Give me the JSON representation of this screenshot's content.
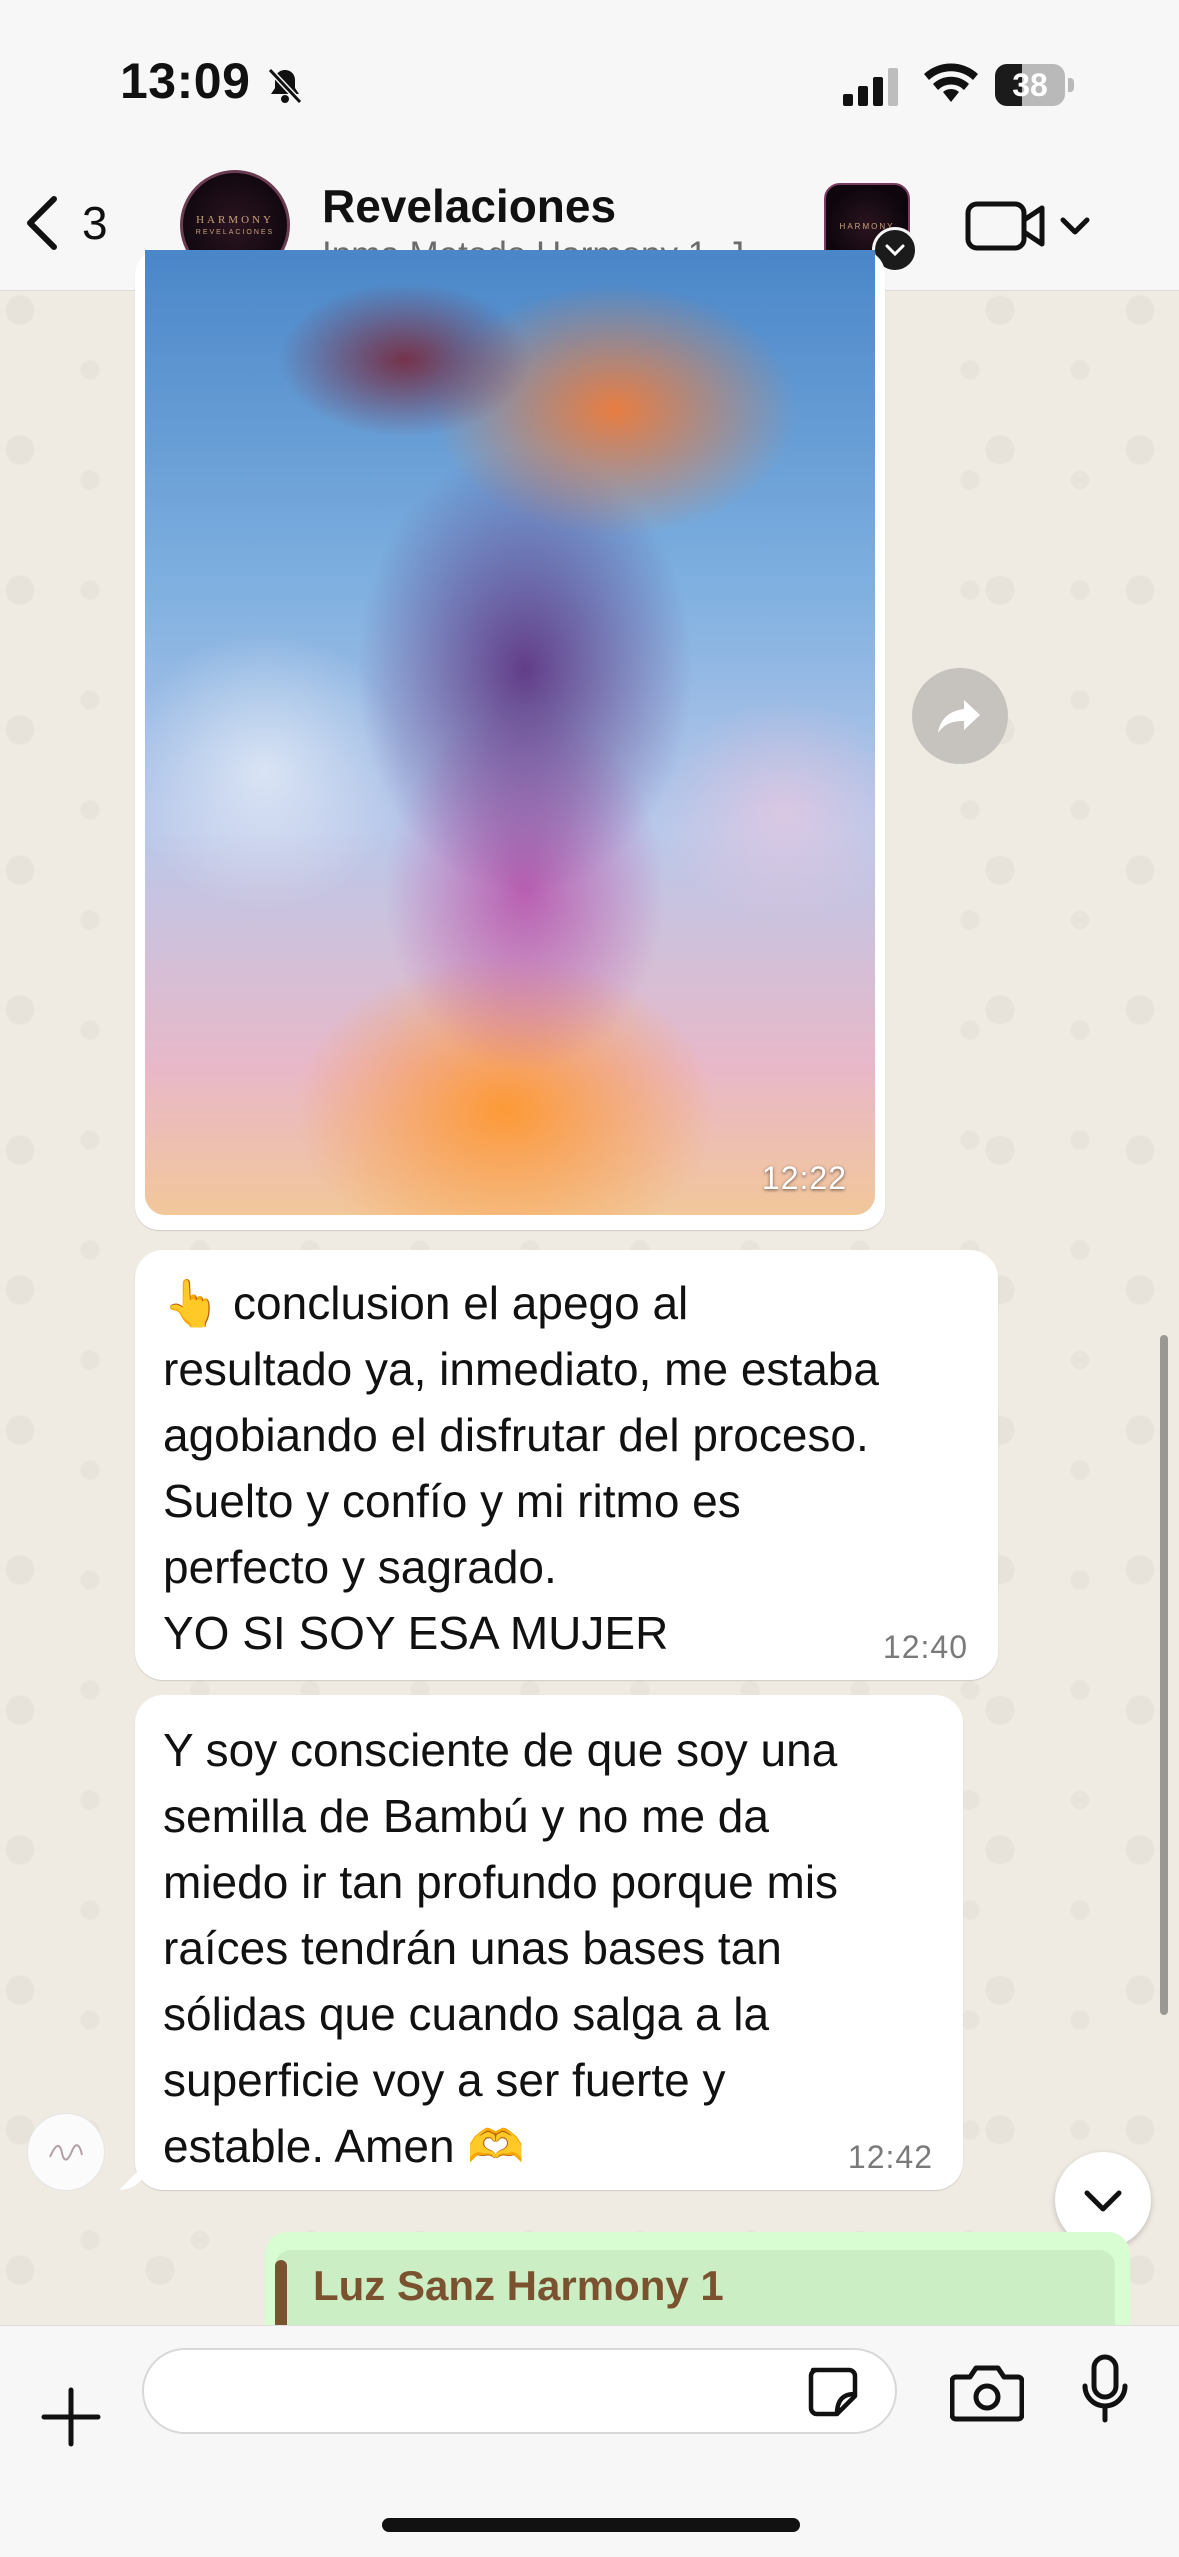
{
  "status_bar": {
    "time": "13:09",
    "battery": "38",
    "battery_level": 0.38
  },
  "header": {
    "back_count": "3",
    "chat_title": "Revelaciones",
    "subtitle": "Inma Metodo Harmony 1, J...",
    "avatar_text_top": "HARMONY",
    "avatar_text_bottom": "REVELACIONES",
    "community_avatar_text": "HARMONY"
  },
  "messages": [
    {
      "type": "image",
      "time": "12:22"
    },
    {
      "type": "text",
      "emoji": "👆",
      "text": " conclusion el apego al\nresultado ya, inmediato, me estaba\nagobiando el disfrutar del proceso.\nSuelto y confío y mi ritmo es\nperfecto y sagrado.\nYO SI SOY ESA MUJER",
      "time": "12:40"
    },
    {
      "type": "text",
      "text": "Y soy consciente de que soy una\nsemilla de Bambú y no me da\nmiedo ir tan profundo porque mis\nraíces tendrán unas bases tan\nsólidas que cuando salga a la\nsuperficie voy a ser fuerte y\nestable. Amen ",
      "emoji_end": "🫶",
      "time": "12:42"
    }
  ],
  "outgoing_preview": {
    "quoted_name": "Luz Sanz Harmony 1"
  },
  "input": {
    "placeholder": ""
  },
  "colors": {
    "chat_bg": "#efeae2",
    "bubble_in": "#ffffff",
    "bubble_out": "#d9fdd3",
    "quote_name": "#7a5230",
    "bar_bg": "#f7f7f7"
  }
}
